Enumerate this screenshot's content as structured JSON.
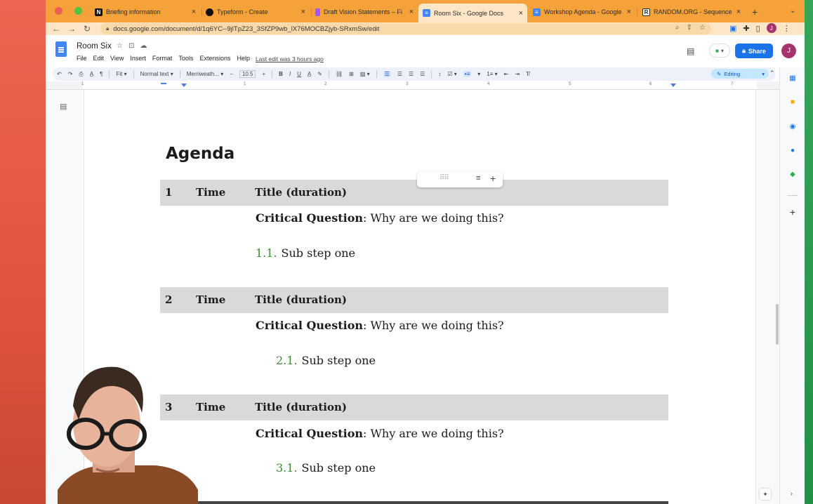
{
  "browser": {
    "tabs": [
      {
        "label": "Briefing information",
        "favicon": "notion-icon",
        "fav_color": "#111111",
        "fav_glyph": "N"
      },
      {
        "label": "Typeform - Create",
        "favicon": "typeform-icon",
        "fav_color": "#111111",
        "fav_glyph": ""
      },
      {
        "label": "Draft Vision Statements – Fi",
        "favicon": "figma-icon",
        "fav_color": "#a259ff",
        "fav_glyph": ""
      },
      {
        "label": "Room Six - Google Docs",
        "favicon": "docs-icon",
        "fav_color": "#4285f4",
        "fav_glyph": "≡"
      },
      {
        "label": "Workshop Agenda - Google",
        "favicon": "docs-icon",
        "fav_color": "#4285f4",
        "fav_glyph": "≡"
      },
      {
        "label": "RANDOM.ORG - Sequence G",
        "favicon": "random-org-icon",
        "fav_color": "#222222",
        "fav_glyph": "R"
      }
    ],
    "close_glyph": "×",
    "new_tab_glyph": "+",
    "url": "docs.google.com/document/d/1q6YC--9jlTpZ23_3SfZP9wb_lX76MOCBZjyb-SRxmSw/edit",
    "profile_initial": "J"
  },
  "doc": {
    "title": "Room Six",
    "menu": [
      "File",
      "Edit",
      "View",
      "Insert",
      "Format",
      "Tools",
      "Extensions",
      "Help"
    ],
    "last_edit": "Last edit was 3 hours ago",
    "share_label": "Share",
    "user_initial": "J"
  },
  "toolbar": {
    "zoom": "Fit",
    "style": "Normal text",
    "font": "Merriweath...",
    "font_size": "10.5",
    "mode": "Editing"
  },
  "ruler": {
    "numbers": [
      "1",
      "1",
      "2",
      "3",
      "4",
      "5",
      "6",
      "7"
    ]
  },
  "content": {
    "heading": "Agenda",
    "sections": [
      {
        "number": "1",
        "time": "Time",
        "title": "Title (duration)",
        "cq_label": "Critical Question",
        "cq_text": ": Why are we doing this?",
        "sub_num": "1.1.",
        "sub_text": "Sub step one"
      },
      {
        "number": "2",
        "time": "Time",
        "title": "Title (duration)",
        "cq_label": "Critical Question",
        "cq_text": ": Why are we doing this?",
        "sub_num": "2.1.",
        "sub_text": "Sub step one"
      },
      {
        "number": "3",
        "time": "Time",
        "title": "Title (duration)",
        "cq_label": "Critical Question",
        "cq_text": ": Why are we doing this?",
        "sub_num": "3.1.",
        "sub_text": "Sub step one"
      }
    ]
  },
  "colors": {
    "tabstrip": "#f6a23a",
    "share_button": "#1a73e8",
    "section_bar": "#d9d9d9",
    "sub_number": "#3d8b37",
    "avatar": "#a8326d"
  }
}
